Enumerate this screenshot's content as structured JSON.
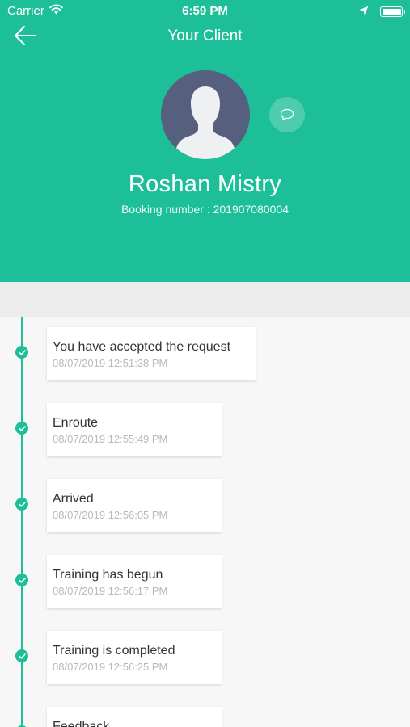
{
  "status_bar": {
    "carrier": "Carrier",
    "time": "6:59 PM"
  },
  "nav": {
    "title": "Your Client"
  },
  "client": {
    "name": "Roshan Mistry",
    "booking": "Booking number : 201907080004"
  },
  "colors": {
    "accent": "#1dbf98",
    "avatar_bg": "#565f7d"
  },
  "timeline": [
    {
      "title": "You have accepted the request",
      "time": "08/07/2019 12:51:38 PM"
    },
    {
      "title": "Enroute",
      "time": "08/07/2019 12:55:49 PM"
    },
    {
      "title": "Arrived",
      "time": "08/07/2019 12:56:05 PM"
    },
    {
      "title": "Training has begun",
      "time": "08/07/2019 12:56:17 PM"
    },
    {
      "title": "Training is completed",
      "time": "08/07/2019 12:56:25 PM"
    },
    {
      "title": "Feedback",
      "time": ""
    }
  ]
}
